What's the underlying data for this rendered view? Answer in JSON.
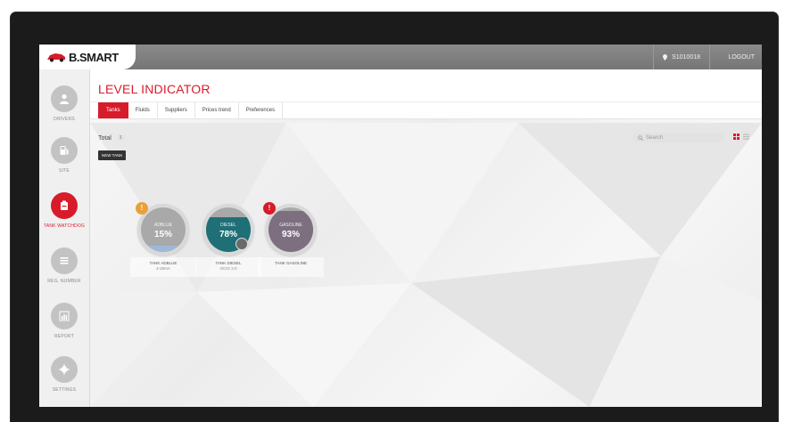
{
  "app": {
    "logo_text": "B.SMART",
    "user": "S1010018",
    "logout_label": "LOGOUT"
  },
  "sidebar": {
    "items": [
      {
        "label": "DRIVERS",
        "icon": "person-icon",
        "active": false
      },
      {
        "label": "SITE",
        "icon": "fuel-pump-icon",
        "active": false
      },
      {
        "label": "TANK WATCHDOG",
        "icon": "tank-icon",
        "active": true
      },
      {
        "label": "REG. NUMBER",
        "icon": "list-icon",
        "active": false
      },
      {
        "label": "REPORT",
        "icon": "bar-chart-icon",
        "active": false
      },
      {
        "label": "SETTINGS",
        "icon": "gear-icon",
        "active": false
      }
    ]
  },
  "page": {
    "title": "LEVEL INDICATOR",
    "tabs": [
      "Tanks",
      "Fluids",
      "Suppliers",
      "Prices trend",
      "Preferences"
    ],
    "active_tab": "Tanks",
    "total_label": "Total",
    "total_count": "3",
    "new_tank_label": "NEW TANK",
    "search_placeholder": "Search"
  },
  "tanks": [
    {
      "name": "TANK ADBLUE",
      "sub": "4-20mA",
      "fluid": "ADBLUE",
      "level_text": "15%",
      "level": 0.15,
      "alert": "!",
      "alert_color": "#e8a13a",
      "fill_color": "#9fb8d6",
      "body_color": "#a9a9a9"
    },
    {
      "name": "TANK DIESEL",
      "sub": "OCIO 2.0",
      "fluid": "DIESEL",
      "level_text": "78%",
      "level": 0.78,
      "alert": "",
      "alert_color": "",
      "fill_color": "#1f6f77",
      "body_color": "#a9a9a9"
    },
    {
      "name": "TANK GASOLINE",
      "sub": "",
      "fluid": "GASOLINE",
      "level_text": "93%",
      "level": 0.93,
      "alert": "!",
      "alert_color": "#d81b2a",
      "fill_color": "#7d6f80",
      "body_color": "#a9a9a9"
    }
  ],
  "colors": {
    "accent": "#d81b2a",
    "topbar": "#7f7f7f",
    "sidebar": "#f0f0f0"
  }
}
